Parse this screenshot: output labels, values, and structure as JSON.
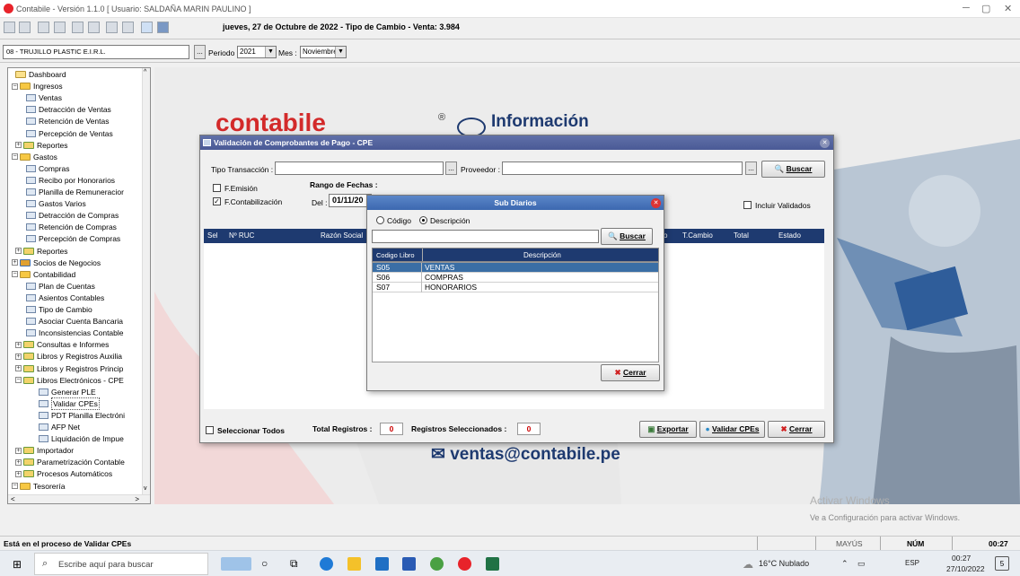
{
  "window": {
    "title": "Contabile - Versión 1.1.0   [ Usuario: SALDAÑA MARIN PAULINO ]",
    "minimize": "─",
    "maximize": "▢",
    "close": "✕"
  },
  "header": {
    "date_line": "jueves, 27 de Octubre de 2022 - Tipo de Cambio - Venta: 3.984"
  },
  "filter": {
    "company": "08 - TRUJILLO PLASTIC E.I.R.L.",
    "browse": "...",
    "period_label": "Periodo :",
    "period_value": "2021",
    "month_label": "Mes :",
    "month_value": "Noviembre"
  },
  "tree": {
    "items": [
      {
        "label": "Dashboard",
        "level": 1,
        "icon": "folder-icon"
      },
      {
        "label": "Ingresos",
        "level": 0,
        "icon": "folder-open-icon",
        "exp": "−"
      },
      {
        "label": "Ventas",
        "level": 2,
        "icon": "document-icon"
      },
      {
        "label": "Detracción de Ventas",
        "level": 2,
        "icon": "document-icon"
      },
      {
        "label": "Retención de Ventas",
        "level": 2,
        "icon": "document-icon"
      },
      {
        "label": "Percepción de Ventas",
        "level": 2,
        "icon": "document-icon"
      },
      {
        "label": "Reportes",
        "level": 1,
        "icon": "reports-icon",
        "exp": "+"
      },
      {
        "label": "Gastos",
        "level": 0,
        "icon": "folder-open-icon",
        "exp": "−"
      },
      {
        "label": "Compras",
        "level": 2,
        "icon": "document-icon"
      },
      {
        "label": "Recibo por Honorarios",
        "level": 2,
        "icon": "document-icon"
      },
      {
        "label": "Planilla de Remuneracior",
        "level": 2,
        "icon": "document-icon"
      },
      {
        "label": "Gastos Varios",
        "level": 2,
        "icon": "document-icon"
      },
      {
        "label": "Detracción de Compras",
        "level": 2,
        "icon": "document-icon"
      },
      {
        "label": "Retención de Compras",
        "level": 2,
        "icon": "document-icon"
      },
      {
        "label": "Percepción de Compras",
        "level": 2,
        "icon": "document-icon"
      },
      {
        "label": "Reportes",
        "level": 1,
        "icon": "reports-icon",
        "exp": "+"
      },
      {
        "label": "Socios de Negocios",
        "level": 0,
        "icon": "partners-icon",
        "exp": "+"
      },
      {
        "label": "Contabilidad",
        "level": 0,
        "icon": "folder-open-icon",
        "exp": "−"
      },
      {
        "label": "Plan de Cuentas",
        "level": 2,
        "icon": "document-icon"
      },
      {
        "label": "Asientos Contables",
        "level": 2,
        "icon": "document-icon"
      },
      {
        "label": "Tipo de Cambio",
        "level": 2,
        "icon": "document-icon"
      },
      {
        "label": "Asociar Cuenta Bancaria",
        "level": 2,
        "icon": "document-icon"
      },
      {
        "label": "Inconsistencias Contable",
        "level": 2,
        "icon": "document-icon"
      },
      {
        "label": "Consultas e Informes",
        "level": 1,
        "icon": "reports-icon",
        "exp": "+"
      },
      {
        "label": "Libros y Registros Auxilia",
        "level": 1,
        "icon": "reports-icon",
        "exp": "+"
      },
      {
        "label": "Libros y Registros Princip",
        "level": 1,
        "icon": "reports-icon",
        "exp": "+"
      },
      {
        "label": "Libros Electrónicos - CPE",
        "level": 1,
        "icon": "reports-icon",
        "exp": "−"
      },
      {
        "label": "Generar PLE",
        "level": 3,
        "icon": "document-icon"
      },
      {
        "label": "Validar CPEs",
        "level": 3,
        "icon": "document-icon"
      },
      {
        "label": "PDT Planilla Electróni",
        "level": 3,
        "icon": "document-icon"
      },
      {
        "label": "AFP Net",
        "level": 3,
        "icon": "document-icon"
      },
      {
        "label": "Liquidación de Impue",
        "level": 3,
        "icon": "document-icon"
      },
      {
        "label": "Importador",
        "level": 1,
        "icon": "reports-icon",
        "exp": "+"
      },
      {
        "label": "Parametrización Contable",
        "level": 1,
        "icon": "reports-icon",
        "exp": "+"
      },
      {
        "label": "Procesos Automáticos",
        "level": 1,
        "icon": "reports-icon",
        "exp": "+"
      },
      {
        "label": "Tesorería",
        "level": 0,
        "icon": "folder-open-icon",
        "exp": "−"
      }
    ]
  },
  "background": {
    "brand": "contabile",
    "registered": "®",
    "info": "Información",
    "email": "✉ ventas@contabile.pe",
    "activate_title": "Activar Windows",
    "activate_sub": "Ve a Configuración para activar Windows."
  },
  "cpe_dialog": {
    "title": "Validación de Comprobantes de Pago - CPE",
    "tipo_label": "Tipo Transacción :",
    "proveedor_label": "Proveedor :",
    "browse": "...",
    "buscar": "Buscar",
    "rango_label": "Rango de Fechas :",
    "emision_label": "F.Emisión",
    "contab_label": "F.Contabilización",
    "del_label": "Del :",
    "del_value": "01/11/20",
    "incluir_label": "Incluir Validados",
    "columns": [
      "Sel",
      "Nº RUC",
      "Razón Social",
      "o",
      "T.Cambio",
      "Total",
      "Estado"
    ],
    "seleccionar_todos": "Seleccionar Todos",
    "total_label": "Total Registros :",
    "total_value": "0",
    "sel_label": "Registros Seleccionados :",
    "sel_value": "0",
    "exportar": "Exportar",
    "validar": "Validar CPEs",
    "cerrar": "Cerrar"
  },
  "sub_dialog": {
    "title": "Sub Diarios",
    "codigo": "Código",
    "descripcion": "Descripción",
    "buscar": "Buscar",
    "columns": [
      "Codigo Libro",
      "Descripción"
    ],
    "rows": [
      {
        "code": "S05",
        "desc": "VENTAS"
      },
      {
        "code": "S06",
        "desc": "COMPRAS"
      },
      {
        "code": "S07",
        "desc": "HONORARIOS"
      }
    ],
    "cerrar": "Cerrar"
  },
  "statusbar": {
    "message": "Está en el proceso de Validar CPEs",
    "caps": "MAYÚS",
    "num": "NÚM",
    "time": "00:27"
  },
  "taskbar": {
    "search": "Escribe aquí para buscar",
    "weather": "16°C  Nublado",
    "lang": "ESP",
    "time": "00:27",
    "date": "27/10/2022",
    "notif": "5"
  },
  "colors": {
    "accent": "#e8232a",
    "header": "#1e3a70",
    "select": "#3a6ea5"
  }
}
